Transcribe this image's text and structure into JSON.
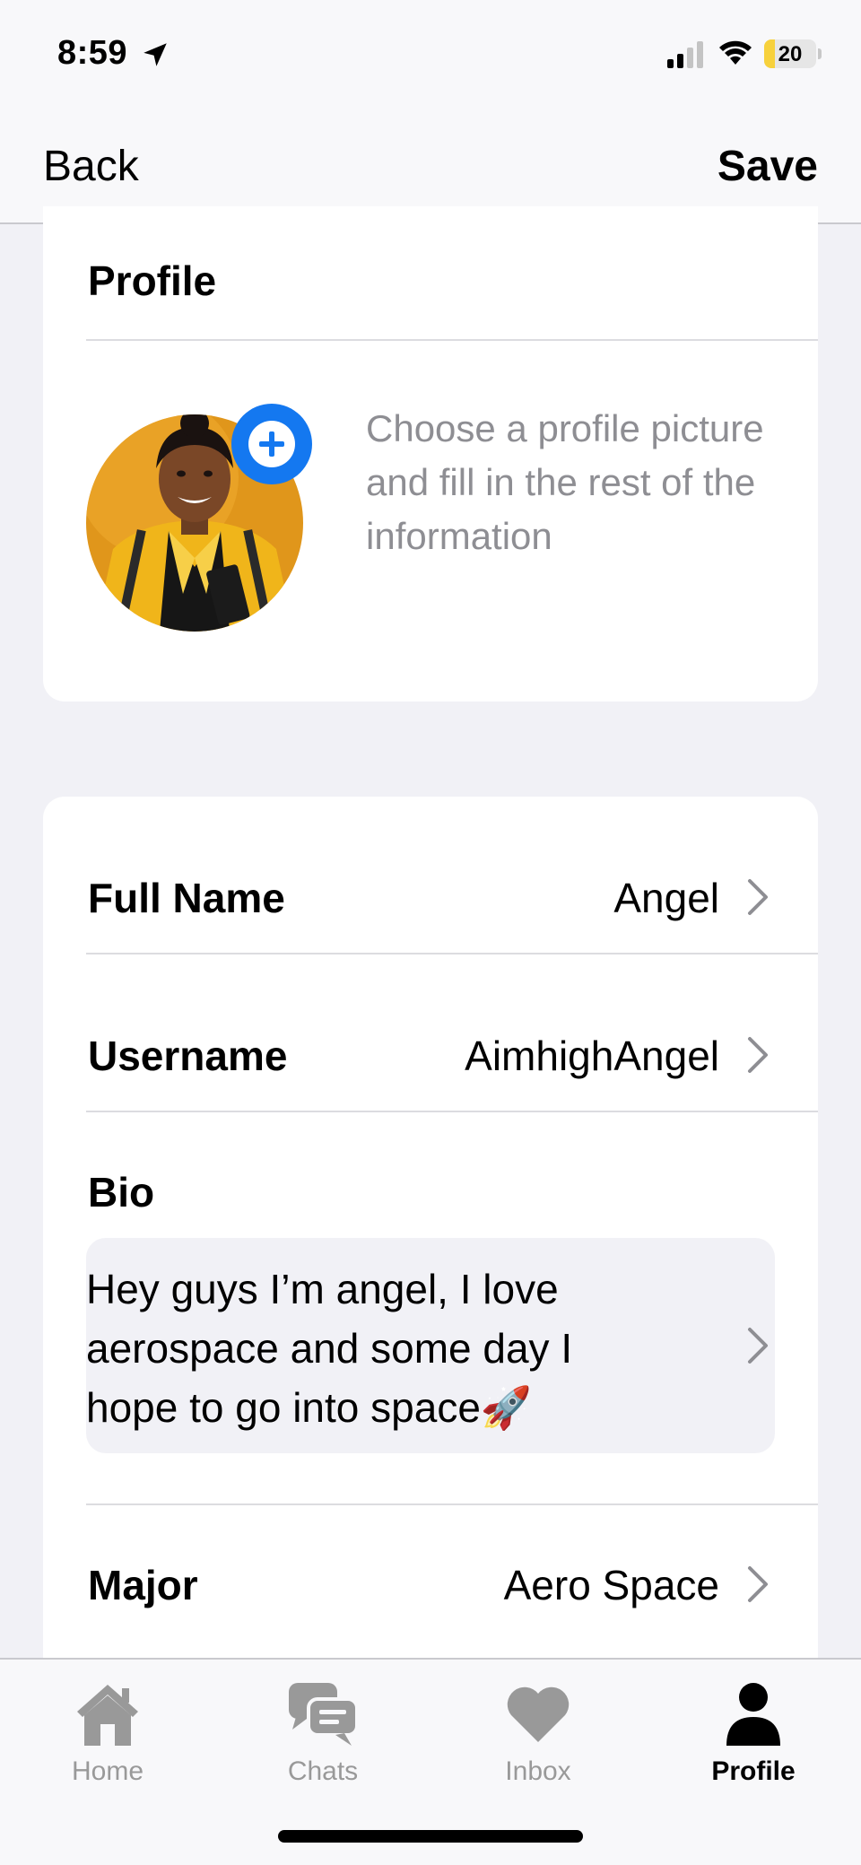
{
  "status_bar": {
    "time": "8:59",
    "battery_level": "20",
    "battery_fraction": 0.2,
    "icons": [
      "location-arrow-icon",
      "cellular-signal-icon",
      "wifi-icon",
      "battery-icon"
    ]
  },
  "nav": {
    "back_label": "Back",
    "save_label": "Save"
  },
  "profile_card": {
    "title": "Profile",
    "hint": "Choose a profile picture and fill in the rest of the information",
    "add_photo_icon": "plus-circle-icon"
  },
  "info": {
    "full_name_label": "Full Name",
    "full_name_value": "Angel",
    "username_label": "Username",
    "username_value": "AimhighAngel",
    "bio_label": "Bio",
    "bio_value": "Hey guys I’m angel, I love aerospace and some day  I hope to go into space🚀",
    "major_label": "Major",
    "major_value": "Aero Space"
  },
  "tabs": [
    {
      "label": "Home",
      "icon": "house-icon",
      "active": false
    },
    {
      "label": "Chats",
      "icon": "chat-bubbles-icon",
      "active": false
    },
    {
      "label": "Inbox",
      "icon": "heart-icon",
      "active": false
    },
    {
      "label": "Profile",
      "icon": "person-icon",
      "active": true
    }
  ],
  "colors": {
    "accent": "#1478f0",
    "background": "#f1f1f6",
    "hint_text": "#8e8e93",
    "tab_inactive": "#999999",
    "battery_fill": "#f7d13c"
  }
}
